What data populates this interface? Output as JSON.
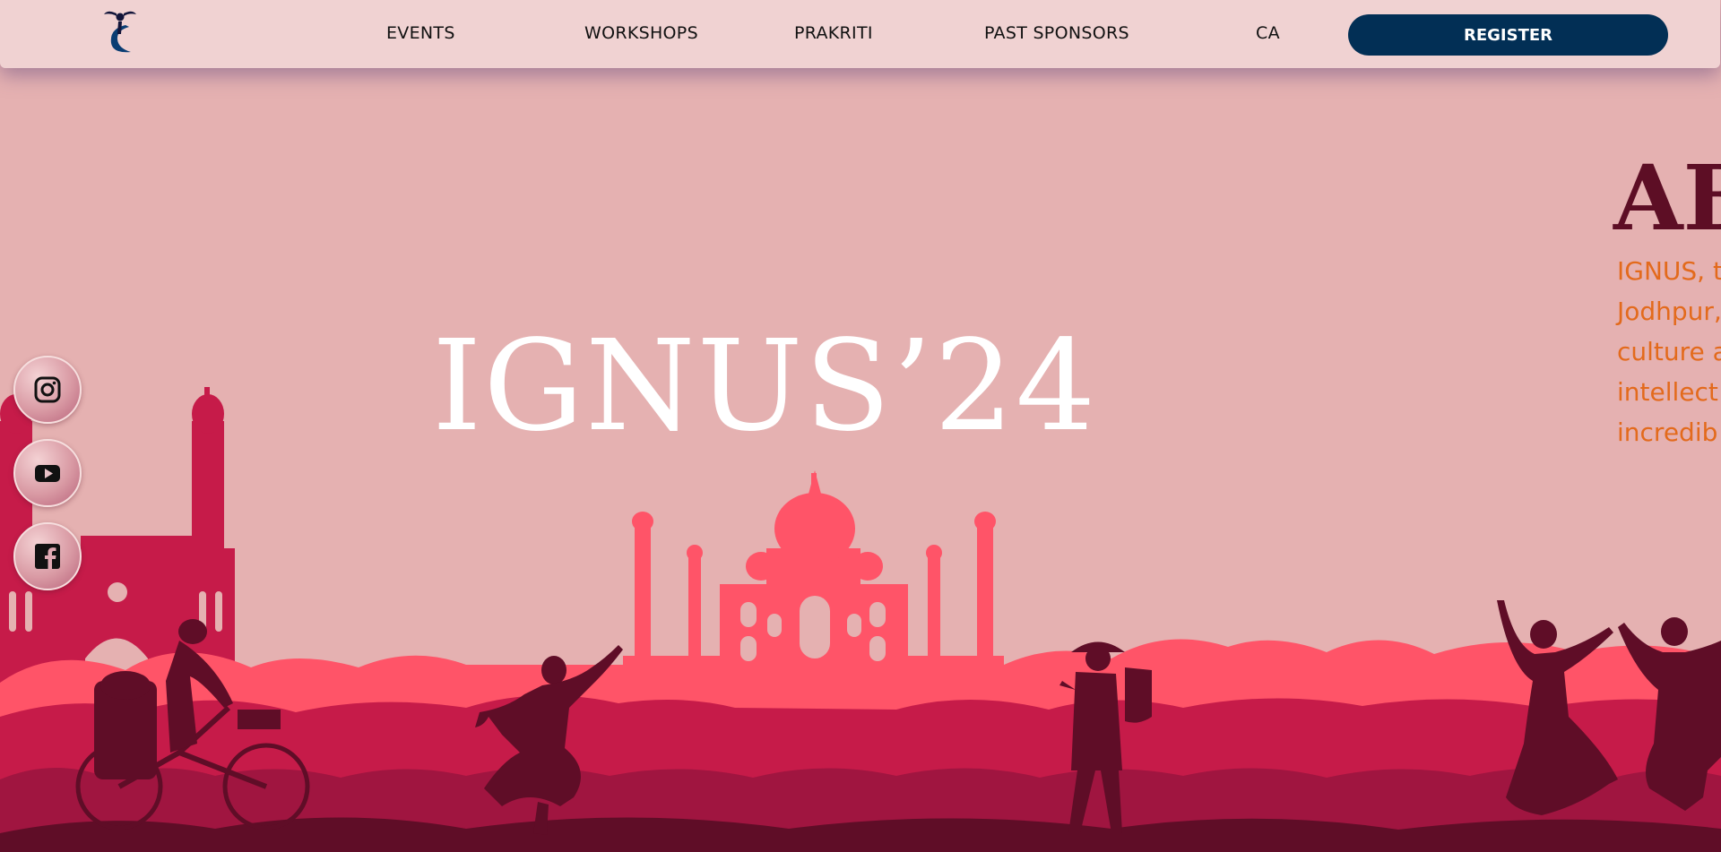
{
  "brand": {
    "logo_icon": "ignus-dancer-logo-icon"
  },
  "nav": {
    "items": [
      {
        "label": "EVENTS"
      },
      {
        "label": "WORKSHOPS"
      },
      {
        "label": "PRAKRITI"
      },
      {
        "label": "PAST SPONSORS"
      },
      {
        "label": "CA"
      }
    ],
    "register_label": "REGISTER"
  },
  "hero": {
    "title": "IGNUS’24"
  },
  "about": {
    "heading": "AB",
    "lines": [
      "IGNUS, t",
      "Jodhpur,",
      "culture a",
      "intellect",
      "incredib"
    ]
  },
  "social": [
    {
      "icon": "instagram-icon"
    },
    {
      "icon": "youtube-icon"
    },
    {
      "icon": "facebook-icon"
    }
  ],
  "colors": {
    "background": "#e5b1b1",
    "navbar": "#f0d2d2",
    "register": "#022f55",
    "about_heading": "#5d0e25",
    "about_text": "#e36a1c",
    "silhouette_light": "#ff5468",
    "silhouette_mid": "#c61b49",
    "silhouette_dark": "#5f0d27"
  }
}
